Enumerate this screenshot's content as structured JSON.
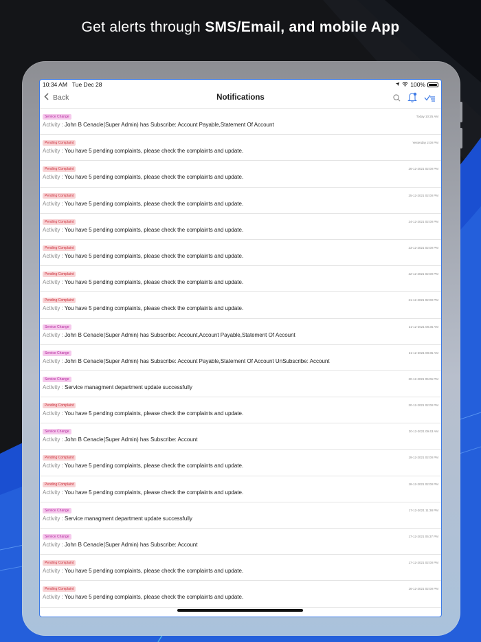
{
  "headline": {
    "regular": "Get alerts through ",
    "bold": "SMS/Email, and mobile App"
  },
  "status_bar": {
    "time": "10:34 AM",
    "date": "Tue Dec 28",
    "battery": "100%"
  },
  "nav": {
    "back_label": "Back",
    "title": "Notifications"
  },
  "activity_label": "Activity :",
  "colors": {
    "accent": "#3e7be6",
    "service_badge_bg": "#f5c9ec",
    "pending_badge_bg": "#f8d3d5"
  },
  "notifications": [
    {
      "type": "service",
      "badge": "Service Change",
      "time": "Today 10:25 AM",
      "text": "John B Cenacle(Super Admin) has Subscribe: Account Payable,Statement Of Account"
    },
    {
      "type": "pending",
      "badge": "Pending Complaint",
      "time": "Yesterday 2:00 PM",
      "text": "You have 5 pending complaints, please check the complaints and update."
    },
    {
      "type": "pending",
      "badge": "Pending Complaint",
      "time": "26-12-2021 02:00 PM",
      "text": "You have 5 pending complaints, please check the complaints and update."
    },
    {
      "type": "pending",
      "badge": "Pending Complaint",
      "time": "25-12-2021 02:00 PM",
      "text": "You have 5 pending complaints, please check the complaints and update."
    },
    {
      "type": "pending",
      "badge": "Pending Complaint",
      "time": "24-12-2021 02:00 PM",
      "text": "You have 5 pending complaints, please check the complaints and update."
    },
    {
      "type": "pending",
      "badge": "Pending Complaint",
      "time": "23-12-2021 02:00 PM",
      "text": "You have 5 pending complaints, please check the complaints and update."
    },
    {
      "type": "pending",
      "badge": "Pending Complaint",
      "time": "22-12-2021 02:00 PM",
      "text": "You have 5 pending complaints, please check the complaints and update."
    },
    {
      "type": "pending",
      "badge": "Pending Complaint",
      "time": "21-12-2021 02:00 PM",
      "text": "You have 5 pending complaints, please check the complaints and update."
    },
    {
      "type": "service",
      "badge": "Service Change",
      "time": "21-12-2021 08:35 AM",
      "text": "John B Cenacle(Super Admin) has Subscribe: Account,Account Payable,Statement Of Account"
    },
    {
      "type": "service",
      "badge": "Service Change",
      "time": "21-12-2021 08:35 AM",
      "text": "John B Cenacle(Super Admin) has Subscribe: Account Payable,Statement Of Account UnSubscribe: Account"
    },
    {
      "type": "service",
      "badge": "Service Change",
      "time": "20-12-2021 05:06 PM",
      "text": "Service managment department update successfully"
    },
    {
      "type": "pending",
      "badge": "Pending Complaint",
      "time": "20-12-2021 02:00 PM",
      "text": "You have 5 pending complaints, please check the complaints and update."
    },
    {
      "type": "service",
      "badge": "Service Change",
      "time": "20-12-2021 09:43 AM",
      "text": "John B Cenacle(Super Admin) has Subscribe: Account"
    },
    {
      "type": "pending",
      "badge": "Pending Complaint",
      "time": "19-12-2021 02:00 PM",
      "text": "You have 5 pending complaints, please check the complaints and update."
    },
    {
      "type": "pending",
      "badge": "Pending Complaint",
      "time": "18-12-2021 02:00 PM",
      "text": "You have 5 pending complaints, please check the complaints and update."
    },
    {
      "type": "service",
      "badge": "Service Change",
      "time": "17-12-2021 11:38 PM",
      "text": "Service managment department update successfully"
    },
    {
      "type": "service",
      "badge": "Service Change",
      "time": "17-12-2021 05:37 PM",
      "text": "John B Cenacle(Super Admin) has Subscribe: Account"
    },
    {
      "type": "pending",
      "badge": "Pending Complaint",
      "time": "17-12-2021 02:00 PM",
      "text": "You have 5 pending complaints, please check the complaints and update."
    },
    {
      "type": "pending",
      "badge": "Pending Complaint",
      "time": "16-12-2021 02:00 PM",
      "text": "You have 5 pending complaints, please check the complaints and update."
    }
  ]
}
